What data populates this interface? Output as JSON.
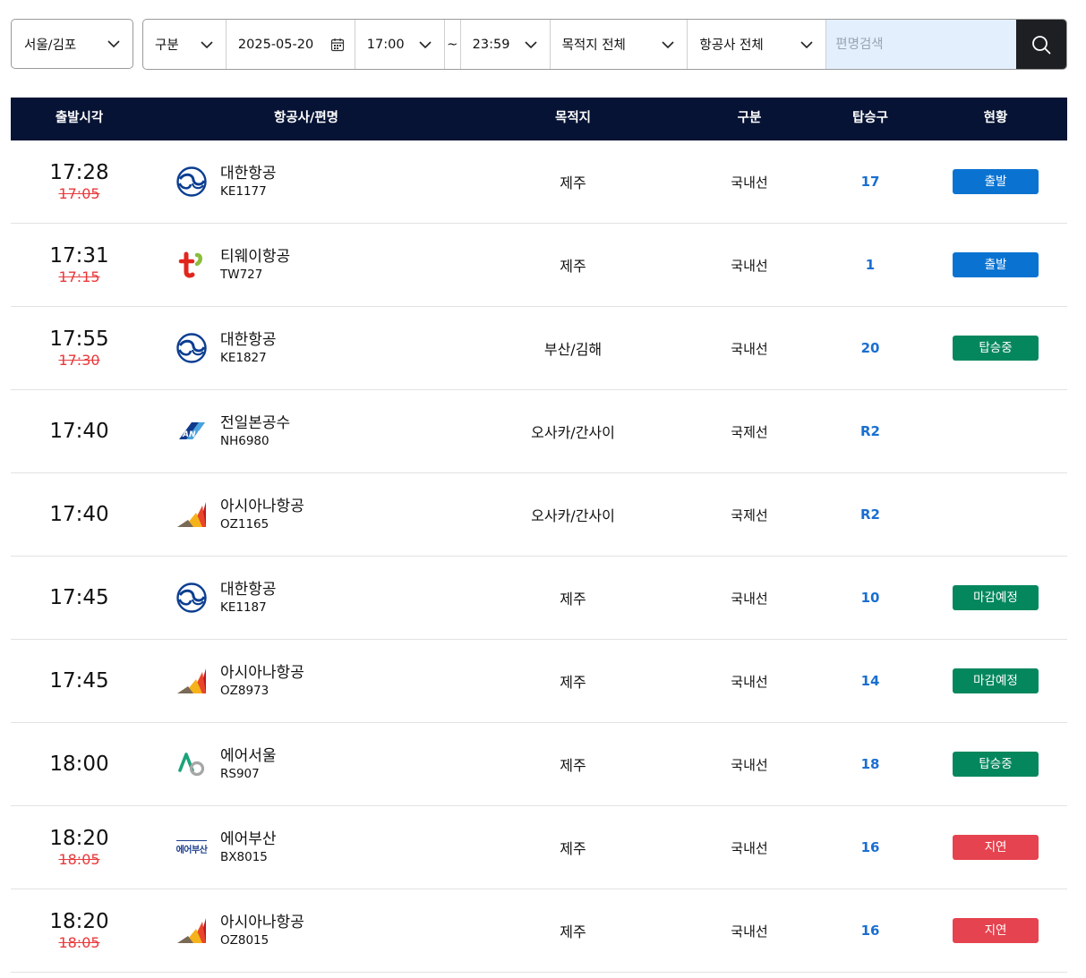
{
  "filters": {
    "airport": "서울/김포",
    "type": "구분",
    "date": "2025-05-20",
    "time_from": "17:00",
    "tilde": "~",
    "time_to": "23:59",
    "destination": "목적지 전체",
    "airline": "항공사 전체",
    "search_placeholder": "편명검색",
    "search_value": ""
  },
  "table": {
    "headers": {
      "time": "출발시각",
      "airline": "항공사/편명",
      "destination": "목적지",
      "type": "구분",
      "gate": "탑승구",
      "status": "현황"
    },
    "rows": [
      {
        "time": "17:28",
        "scheduled": "17:05",
        "airline": "대한항공",
        "flight": "KE1177",
        "logo": "korean-air-logo-icon",
        "destination": "제주",
        "type": "국내선",
        "gate": "17",
        "status": "출발",
        "status_color": "#0a73d1"
      },
      {
        "time": "17:31",
        "scheduled": "17:15",
        "airline": "티웨이항공",
        "flight": "TW727",
        "logo": "tway-logo-icon",
        "destination": "제주",
        "type": "국내선",
        "gate": "1",
        "status": "출발",
        "status_color": "#0a73d1"
      },
      {
        "time": "17:55",
        "scheduled": "17:30",
        "airline": "대한항공",
        "flight": "KE1827",
        "logo": "korean-air-logo-icon",
        "destination": "부산/김해",
        "type": "국내선",
        "gate": "20",
        "status": "탑승중",
        "status_color": "#05875e"
      },
      {
        "time": "17:40",
        "scheduled": "",
        "airline": "전일본공수",
        "flight": "NH6980",
        "logo": "ana-logo-icon",
        "destination": "오사카/간사이",
        "type": "국제선",
        "gate": "R2",
        "status": "",
        "status_color": ""
      },
      {
        "time": "17:40",
        "scheduled": "",
        "airline": "아시아나항공",
        "flight": "OZ1165",
        "logo": "asiana-logo-icon",
        "destination": "오사카/간사이",
        "type": "국제선",
        "gate": "R2",
        "status": "",
        "status_color": ""
      },
      {
        "time": "17:45",
        "scheduled": "",
        "airline": "대한항공",
        "flight": "KE1187",
        "logo": "korean-air-logo-icon",
        "destination": "제주",
        "type": "국내선",
        "gate": "10",
        "status": "마감예정",
        "status_color": "#05875e"
      },
      {
        "time": "17:45",
        "scheduled": "",
        "airline": "아시아나항공",
        "flight": "OZ8973",
        "logo": "asiana-logo-icon",
        "destination": "제주",
        "type": "국내선",
        "gate": "14",
        "status": "마감예정",
        "status_color": "#05875e"
      },
      {
        "time": "18:00",
        "scheduled": "",
        "airline": "에어서울",
        "flight": "RS907",
        "logo": "air-seoul-logo-icon",
        "destination": "제주",
        "type": "국내선",
        "gate": "18",
        "status": "탑승중",
        "status_color": "#05875e"
      },
      {
        "time": "18:20",
        "scheduled": "18:05",
        "airline": "에어부산",
        "flight": "BX8015",
        "logo": "air-busan-logo-icon",
        "logo_text": "에어부산",
        "destination": "제주",
        "type": "국내선",
        "gate": "16",
        "status": "지연",
        "status_color": "#e5434f"
      },
      {
        "time": "18:20",
        "scheduled": "18:05",
        "airline": "아시아나항공",
        "flight": "OZ8015",
        "logo": "asiana-logo-icon",
        "destination": "제주",
        "type": "국내선",
        "gate": "16",
        "status": "지연",
        "status_color": "#e5434f"
      }
    ]
  }
}
